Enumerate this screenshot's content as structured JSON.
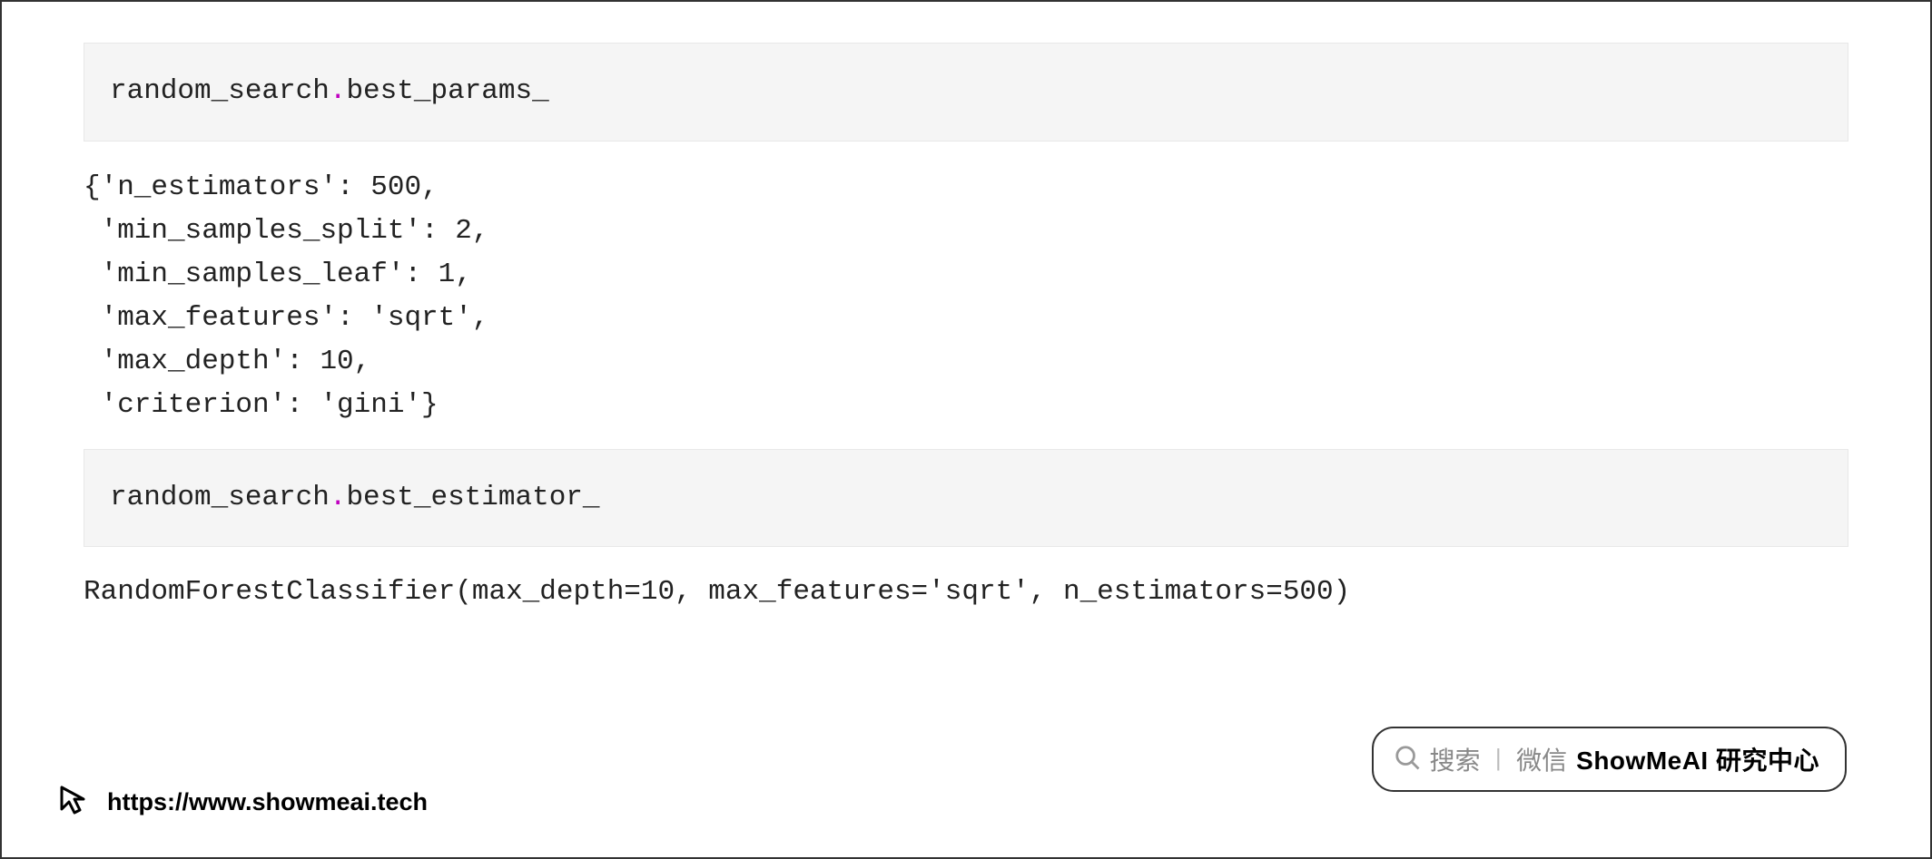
{
  "cell1": {
    "prefix": "random_search",
    "dot": ".",
    "suffix": "best_params_"
  },
  "output1": {
    "text": "{'n_estimators': 500,\n 'min_samples_split': 2,\n 'min_samples_leaf': 1,\n 'max_features': 'sqrt',\n 'max_depth': 10,\n 'criterion': 'gini'}"
  },
  "cell2": {
    "prefix": "random_search",
    "dot": ".",
    "suffix": "best_estimator_"
  },
  "output2": {
    "text": "RandomForestClassifier(max_depth=10, max_features='sqrt', n_estimators=500)"
  },
  "badge": {
    "search_label": "搜索",
    "wechat_label": "微信",
    "brand_label": "ShowMeAI 研究中心"
  },
  "footer": {
    "url": "https://www.showmeai.tech"
  }
}
